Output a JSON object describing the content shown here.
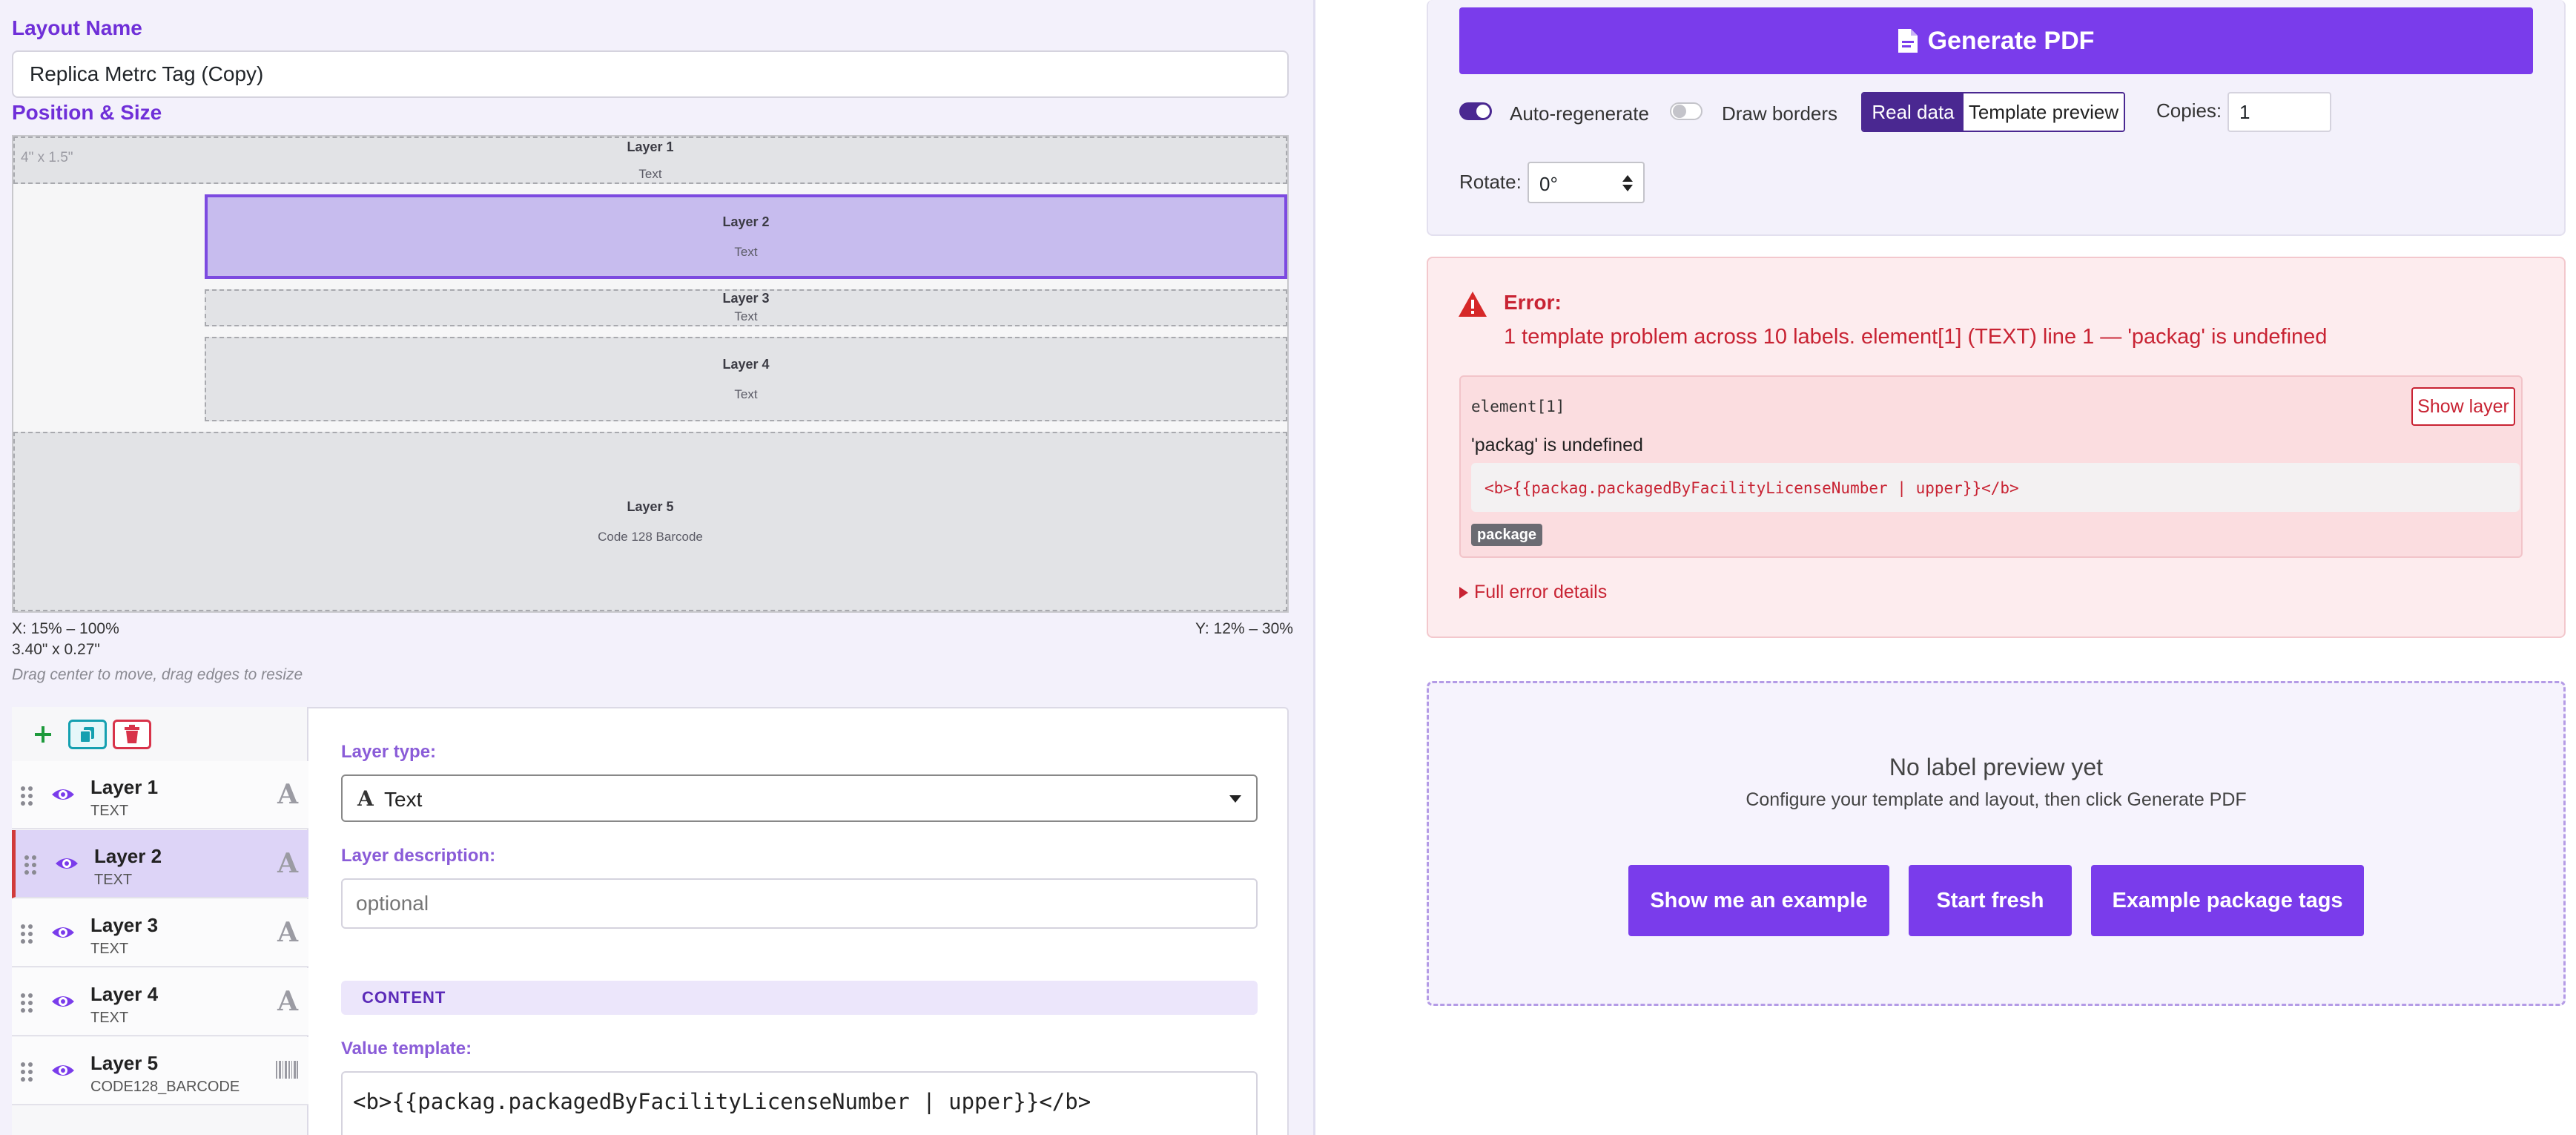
{
  "layout": {
    "name_label": "Layout Name",
    "name_value": "Replica Metrc Tag (Copy)",
    "position_label": "Position & Size",
    "canvas_size": "4\" x 1.5\"",
    "x_range": "X: 15% – 100%",
    "y_range": "Y: 12% – 30%",
    "dimensions": "3.40\" x 0.27\"",
    "hint": "Drag center to move, drag edges to resize"
  },
  "canvas_layers": [
    {
      "name": "Layer 1",
      "type": "Text"
    },
    {
      "name": "Layer 2",
      "type": "Text"
    },
    {
      "name": "Layer 3",
      "type": "Text"
    },
    {
      "name": "Layer 4",
      "type": "Text"
    },
    {
      "name": "Layer 5",
      "type": "Code 128 Barcode"
    }
  ],
  "layer_list": [
    {
      "name": "Layer 1",
      "type": "TEXT",
      "icon": "text-type-icon"
    },
    {
      "name": "Layer 2",
      "type": "TEXT",
      "icon": "text-type-icon"
    },
    {
      "name": "Layer 3",
      "type": "TEXT",
      "icon": "text-type-icon"
    },
    {
      "name": "Layer 4",
      "type": "TEXT",
      "icon": "text-type-icon"
    },
    {
      "name": "Layer 5",
      "type": "CODE128_BARCODE",
      "icon": "barcode-type-icon"
    }
  ],
  "type_glyph": "A",
  "editor": {
    "layer_type_label": "Layer type:",
    "layer_type_value": "Text",
    "desc_label": "Layer description:",
    "desc_placeholder": "optional",
    "content_header": "CONTENT",
    "value_template_label": "Value template:",
    "value_template": "<b>{{packag.packagedByFacilityLicenseNumber | upper}}</b>"
  },
  "controls": {
    "generate": "Generate PDF",
    "auto_regen": "Auto-regenerate",
    "auto_regen_on": true,
    "draw_borders": "Draw borders",
    "draw_borders_on": false,
    "mode_real": "Real data",
    "mode_preview": "Template preview",
    "copies_label": "Copies:",
    "copies_value": "1",
    "rotate_label": "Rotate:",
    "rotate_value": "0°"
  },
  "error": {
    "title": "Error:",
    "message": "1 template problem across 10 labels. element[1] (TEXT) line 1 — 'packag' is undefined",
    "element": "element[1]",
    "show_layer": "Show layer",
    "detail": "'packag' is undefined",
    "code": "<b>{{packag.packagedByFacilityLicenseNumber | upper}}</b>",
    "tag": "package",
    "full_details": "Full error details"
  },
  "preview": {
    "title": "No label preview yet",
    "subtitle": "Configure your template and layout, then click Generate PDF",
    "btn_example": "Show me an example",
    "btn_fresh": "Start fresh",
    "btn_tags": "Example package tags"
  },
  "colors": {
    "accent": "#7a3ceb",
    "error": "#d62828",
    "error_bg": "#fdecee"
  }
}
